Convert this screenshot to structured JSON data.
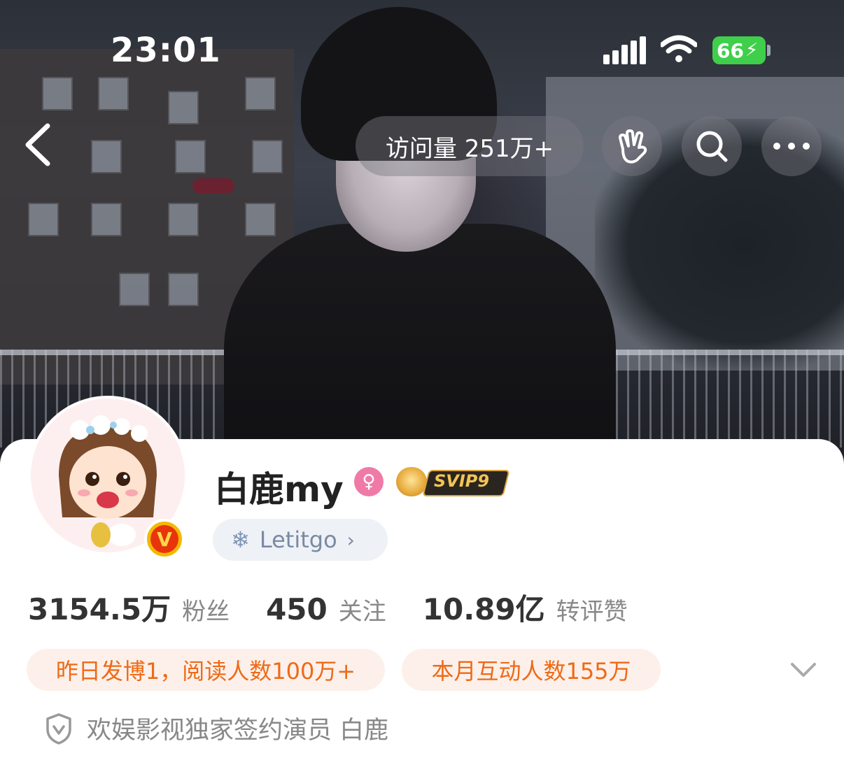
{
  "status_bar": {
    "time": "23:01",
    "battery": "66",
    "icons": [
      "signal-icon",
      "wifi-icon",
      "battery-charging-icon"
    ]
  },
  "nav": {
    "visits_label": "访问量 251万+",
    "icons": [
      "back-arrow-icon",
      "wave-hand-icon",
      "search-icon",
      "more-dots-icon"
    ]
  },
  "profile": {
    "username": "白鹿my",
    "gender_icon": "female-icon",
    "vip_badge": "SVIP9",
    "verified_icon": "verified-v-icon",
    "chip_label": "Letitgo",
    "chip_icon": "snowflake-icon"
  },
  "stats": [
    {
      "value": "3154.5万",
      "label": "粉丝"
    },
    {
      "value": "450",
      "label": "关注"
    },
    {
      "value": "10.89亿",
      "label": "转评赞"
    }
  ],
  "highlights": [
    "昨日发博1，阅读人数100万+",
    "本月互动人数155万"
  ],
  "certification": {
    "icon": "shield-v-icon",
    "text": "欢娱影视独家签约演员 白鹿"
  },
  "colors": {
    "accent_orange": "#ee6a17",
    "pill_bg": "#fdf0ea",
    "battery_green": "#3fcf4b",
    "gender_pink": "#f07aa7",
    "verified_orange": "#e8340c"
  }
}
